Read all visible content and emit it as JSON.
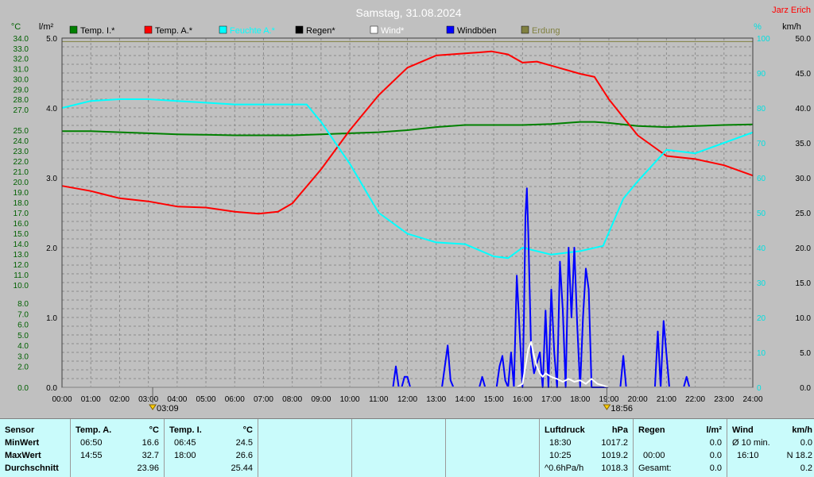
{
  "chart_data": {
    "type": "line",
    "title": "Samstag, 31.08.2024",
    "station": "Jarz Erich",
    "axis_units": {
      "left_temp": "°C",
      "left_rain": "l/m²",
      "right_pct": "%",
      "right_wind": "km/h"
    },
    "x_ticks": [
      "00:00",
      "01:00",
      "02:00",
      "03:00",
      "04:00",
      "05:00",
      "06:00",
      "07:00",
      "08:00",
      "09:00",
      "10:00",
      "11:00",
      "12:00",
      "13:00",
      "14:00",
      "15:00",
      "16:00",
      "17:00",
      "18:00",
      "19:00",
      "20:00",
      "21:00",
      "22:00",
      "23:00",
      "24:00"
    ],
    "temp_ticks": [
      "34.0",
      "33.0",
      "32.0",
      "31.0",
      "30.0",
      "29.0",
      "28.0",
      "27.0",
      "25.0",
      "24.0",
      "23.0",
      "22.0",
      "21.0",
      "20.0",
      "19.0",
      "18.0",
      "17.0",
      "16.0",
      "15.0",
      "14.0",
      "13.0",
      "12.0",
      "11.0",
      "10.0",
      "8.0",
      "7.0",
      "6.0",
      "5.0",
      "4.0",
      "3.0",
      "2.0",
      "0.0"
    ],
    "rain_ticks": [
      "5.0",
      "4.0",
      "3.0",
      "2.0",
      "1.0",
      "0.0"
    ],
    "pct_ticks": [
      "100",
      "90",
      "80",
      "70",
      "60",
      "50",
      "40",
      "30",
      "20",
      "10",
      "0"
    ],
    "wind_ticks": [
      "50.0",
      "45.0",
      "40.0",
      "35.0",
      "30.0",
      "25.0",
      "20.0",
      "15.0",
      "10.0",
      "5.0",
      "0.0"
    ],
    "legend": [
      {
        "label": "Temp. I.*",
        "color": "#008000"
      },
      {
        "label": "Temp. A.*",
        "color": "#ff0000"
      },
      {
        "label": "Feuchte A.*",
        "color": "#00ffff"
      },
      {
        "label": "Regen*",
        "color": "#000000"
      },
      {
        "label": "Wind*",
        "color": "#ffffff"
      },
      {
        "label": "Windböen",
        "color": "#0000ff"
      },
      {
        "label": "Erdung",
        "color": "#808040"
      }
    ],
    "events": [
      {
        "time": "03:09",
        "hour": 3.15
      },
      {
        "time": "18:56",
        "hour": 18.93
      }
    ],
    "series": [
      {
        "name": "Temp. I.*",
        "axis": "temp",
        "color": "#008000",
        "x": [
          0,
          1,
          2,
          3,
          4,
          5,
          6,
          7,
          8,
          9,
          10,
          11,
          12,
          13,
          14,
          15,
          16,
          17,
          18,
          18.5,
          19,
          20,
          21,
          22,
          23,
          24
        ],
        "y": [
          24.9,
          24.9,
          24.8,
          24.7,
          24.6,
          24.55,
          24.5,
          24.5,
          24.5,
          24.6,
          24.7,
          24.8,
          25.0,
          25.3,
          25.5,
          25.5,
          25.5,
          25.6,
          25.8,
          25.8,
          25.7,
          25.4,
          25.3,
          25.4,
          25.5,
          25.55
        ]
      },
      {
        "name": "Temp. A.*",
        "axis": "temp",
        "color": "#ff0000",
        "x": [
          0,
          1,
          2,
          3,
          4,
          5,
          6,
          6.83,
          7.5,
          8,
          9,
          10,
          11,
          12,
          13,
          14,
          14.5,
          14.92,
          15.5,
          16,
          16.5,
          17,
          18,
          18.5,
          19,
          20,
          21,
          22,
          23,
          24
        ],
        "y": [
          19.6,
          19.1,
          18.4,
          18.1,
          17.6,
          17.5,
          17.1,
          16.9,
          17.1,
          17.9,
          21.2,
          25.0,
          28.4,
          31.1,
          32.3,
          32.5,
          32.6,
          32.7,
          32.4,
          31.6,
          31.7,
          31.3,
          30.5,
          30.2,
          28.0,
          24.5,
          22.5,
          22.2,
          21.6,
          20.6
        ]
      },
      {
        "name": "Feuchte A.*",
        "axis": "pct",
        "color": "#00ffff",
        "x": [
          0,
          1,
          2,
          3,
          4,
          5,
          6,
          7,
          8,
          8.5,
          9,
          10,
          11,
          12,
          13,
          14,
          15,
          15.5,
          16,
          17,
          18,
          18.8,
          19.5,
          20,
          21,
          22,
          23,
          24
        ],
        "y": [
          80,
          82,
          82.5,
          82.5,
          82,
          81.5,
          81,
          81,
          81,
          81,
          76,
          64,
          50,
          44,
          41.5,
          41,
          37.5,
          37,
          40,
          38,
          39,
          40.5,
          54,
          59,
          68,
          67,
          70,
          73
        ]
      },
      {
        "name": "Windböen",
        "axis": "wind",
        "color": "#0000ff",
        "x": [
          0,
          11.5,
          11.6,
          11.7,
          11.8,
          11.9,
          12,
          12.1,
          12.2,
          12.3,
          13.2,
          13.3,
          13.4,
          13.5,
          13.6,
          14.5,
          14.6,
          14.7,
          15.1,
          15.2,
          15.3,
          15.4,
          15.5,
          15.6,
          15.7,
          15.8,
          16,
          16.05,
          16.1,
          16.15,
          16.2,
          16.3,
          16.4,
          16.6,
          16.7,
          16.8,
          16.9,
          17,
          17.1,
          17.2,
          17.3,
          17.4,
          17.5,
          17.6,
          17.7,
          17.8,
          17.9,
          18,
          18.1,
          18.2,
          18.3,
          18.4,
          18.5,
          18.6,
          18.7,
          19,
          19.4,
          19.5,
          19.6,
          19.7,
          20,
          20.6,
          20.7,
          20.8,
          20.9,
          21.1,
          21.2,
          21.3,
          21.5,
          21.6,
          21.7,
          21.8,
          22,
          24
        ],
        "y": [
          0,
          0,
          3,
          0,
          0,
          1.5,
          1.5,
          0,
          0,
          0,
          0,
          3,
          6,
          1,
          0,
          0,
          1.5,
          0,
          0,
          3,
          4.5,
          1,
          0,
          5,
          0,
          16,
          0,
          10,
          24.5,
          28.5,
          22,
          5,
          2,
          5,
          0,
          11,
          0,
          14,
          5,
          0,
          18,
          11,
          0,
          20,
          10,
          20,
          9,
          0,
          10,
          17,
          14,
          0,
          0,
          0,
          0,
          0,
          0,
          4.5,
          0,
          0,
          0,
          0,
          8,
          0,
          9.5,
          0,
          0,
          0,
          0,
          0,
          1.5,
          0,
          0,
          0
        ]
      },
      {
        "name": "Wind*",
        "axis": "wind",
        "color": "#ffffff",
        "x": [
          0,
          15.8,
          16,
          16.1,
          16.2,
          16.3,
          16.4,
          16.5,
          16.6,
          16.7,
          16.8,
          17,
          17.2,
          17.4,
          17.6,
          17.8,
          18,
          18.2,
          18.4,
          18.6,
          19,
          24
        ],
        "y": [
          0,
          0,
          0.5,
          3,
          5.5,
          6.5,
          4.5,
          3,
          2,
          1.5,
          2,
          1.5,
          1.2,
          0.8,
          1.2,
          0.8,
          1,
          0.5,
          1.2,
          0.5,
          0,
          0
        ]
      },
      {
        "name": "Erdung",
        "axis": "pct",
        "color": "#808040",
        "x": [
          0,
          24
        ],
        "y": [
          99,
          99
        ]
      }
    ]
  },
  "stats": {
    "sensor": {
      "header": "Sensor",
      "rows": [
        "MinWert",
        "MaxWert",
        "Durchschnitt"
      ]
    },
    "temp_a": {
      "header": "Temp. A.",
      "unit": "°C",
      "rows": [
        [
          "06:50",
          "16.6"
        ],
        [
          "14:55",
          "32.7"
        ],
        [
          "",
          "23.96"
        ]
      ]
    },
    "temp_i": {
      "header": "Temp. I.",
      "unit": "°C",
      "rows": [
        [
          "06:45",
          "24.5"
        ],
        [
          "18:00",
          "26.6"
        ],
        [
          "",
          "25.44"
        ]
      ]
    },
    "druck": {
      "header": "Luftdruck",
      "unit": "hPa",
      "rows": [
        [
          "18:30",
          "1017.2"
        ],
        [
          "10:25",
          "1019.2"
        ],
        [
          "^0.6hPa/h",
          "1018.3"
        ]
      ]
    },
    "regen": {
      "header": "Regen",
      "unit": "l/m²",
      "rows": [
        [
          "",
          "0.0"
        ],
        [
          "00:00",
          "0.0"
        ],
        [
          "Gesamt:",
          "0.0"
        ]
      ]
    },
    "wind": {
      "header": "Wind",
      "unit": "km/h",
      "rows": [
        [
          "Ø 10 min.",
          "0.0"
        ],
        [
          "16:10",
          "N 18.2"
        ],
        [
          "",
          "0.2"
        ]
      ]
    }
  }
}
